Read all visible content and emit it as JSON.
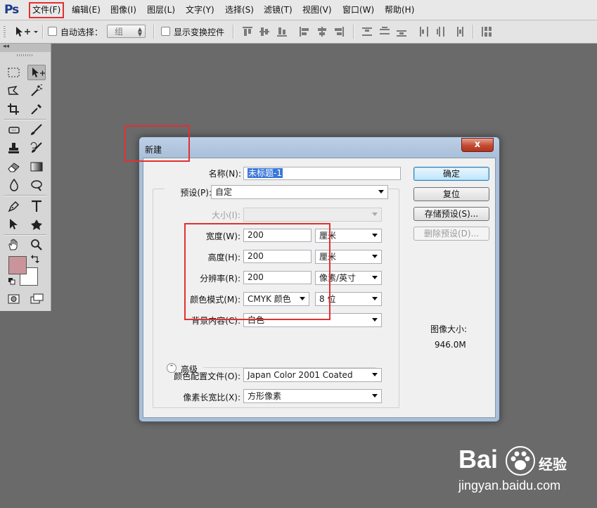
{
  "app": {
    "logo": "Ps"
  },
  "menu": {
    "items": [
      "文件(F)",
      "编辑(E)",
      "图像(I)",
      "图层(L)",
      "文字(Y)",
      "选择(S)",
      "滤镜(T)",
      "视图(V)",
      "窗口(W)",
      "帮助(H)"
    ],
    "highlighted_index": 0
  },
  "options_bar": {
    "auto_select_label": "自动选择：",
    "auto_select_checked": false,
    "group_value": "组",
    "show_transform_label": "显示变换控件",
    "show_transform_checked": false
  },
  "toolbar": {
    "collapse_glyph": "◂◂",
    "foreground_color": "#c9959b",
    "background_color": "#ffffff"
  },
  "dialog": {
    "title": "新建",
    "close_glyph": "x",
    "name_label": "名称(N):",
    "name_value": "未标题-1",
    "preset_label": "预设(P):",
    "preset_value": "自定",
    "size_label": "大小(I):",
    "size_value": "",
    "width_label": "宽度(W):",
    "width_value": "200",
    "width_unit": "厘米",
    "height_label": "高度(H):",
    "height_value": "200",
    "height_unit": "厘米",
    "resolution_label": "分辨率(R):",
    "resolution_value": "200",
    "resolution_unit": "像素/英寸",
    "color_mode_label": "颜色模式(M):",
    "color_mode_value": "CMYK 颜色",
    "bit_depth_value": "8 位",
    "background_label": "背景内容(C):",
    "background_value": "白色",
    "advanced_label": "高级",
    "color_profile_label": "颜色配置文件(O):",
    "color_profile_value": "Japan Color 2001 Coated",
    "pixel_aspect_label": "像素长宽比(X):",
    "pixel_aspect_value": "方形像素",
    "buttons": {
      "ok": "确定",
      "reset": "复位",
      "save_preset": "存储预设(S)...",
      "delete_preset": "删除预设(D)..."
    },
    "image_size_label": "图像大小:",
    "image_size_value": "946.0M"
  },
  "watermark": {
    "brand": "Bai",
    "brand_suffix": "经验",
    "url": "jingyan.baidu.com"
  },
  "colors": {
    "highlight": "#e23030",
    "canvas": "#6a6a6a",
    "selection": "#3b78d8"
  }
}
